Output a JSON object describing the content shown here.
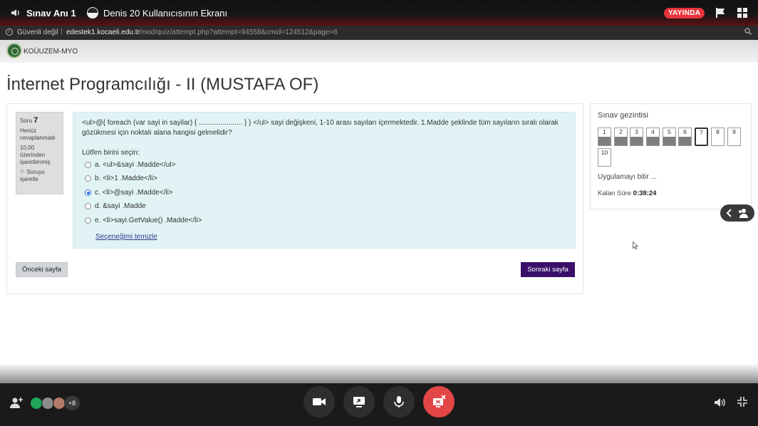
{
  "call": {
    "meeting_title": "Sınav Anı 1",
    "share_title": "Denis 20 Kullanıcısının Ekranı",
    "live_badge": "YAYINDA",
    "live_color": "#e8333a",
    "participants_more": "+8",
    "end_color": "#e34647"
  },
  "browser": {
    "security": "Güvenli değil",
    "separator": "|",
    "host": "edestek1.kocaeli.edu.tr",
    "path": "/mod/quiz/attempt.php?attempt=94558&cmid=124512&page=6"
  },
  "site": {
    "name": "KOÜUZEM-MYO"
  },
  "course": {
    "title": "İnternet Programcılığı - II (MUSTAFA OF)"
  },
  "question_info": {
    "label": "Soru",
    "number": "7",
    "state": "Henüz cevaplanmadı",
    "grade": "10,00 üzerinden işaretlenmiş",
    "flag": "Soruyu işaretle"
  },
  "question": {
    "text": "<ul>@{ foreach (var sayi in sayilar) { ...................... } } </ul> sayi değişkeni, 1-10 arası sayıları içermektedir. 1.Madde şeklinde tüm sayıların sıralı olarak gözükmesi için noktalı alana hangisi gelmelidir?",
    "prompt": "Lütfen birini seçin:",
    "answers": [
      {
        "label": "a. <ul>&sayi .Madde</ul>",
        "selected": false
      },
      {
        "label": "b. <li>1 .Madde</li>",
        "selected": false
      },
      {
        "label": "c. <li>@sayi .Madde</li>",
        "selected": true
      },
      {
        "label": "d. &sayi .Madde",
        "selected": false
      },
      {
        "label": "e. <li>sayi.GetValue() .Madde</li>",
        "selected": false
      }
    ],
    "clear_choice": "Seçeneğimi temizle"
  },
  "buttons": {
    "previous": "Önceki sayfa",
    "next": "Sonraki sayfa",
    "next_color": "#3a0f6a"
  },
  "navigation": {
    "title": "Sınav gezintisi",
    "questions": [
      {
        "label": "1",
        "answered": true,
        "current": false
      },
      {
        "label": "2",
        "answered": true,
        "current": false
      },
      {
        "label": "3",
        "answered": true,
        "current": false
      },
      {
        "label": "4",
        "answered": true,
        "current": false
      },
      {
        "label": "5",
        "answered": true,
        "current": false
      },
      {
        "label": "6",
        "answered": true,
        "current": false
      },
      {
        "label": "7",
        "answered": false,
        "current": true
      },
      {
        "label": "8",
        "answered": false,
        "current": false
      },
      {
        "label": "9",
        "answered": false,
        "current": false
      },
      {
        "label": "10",
        "answered": false,
        "current": false
      }
    ],
    "finish": "Uygulamayı bitir ...",
    "time_label": "Kalan Süre",
    "time_value": "0:38:24"
  }
}
